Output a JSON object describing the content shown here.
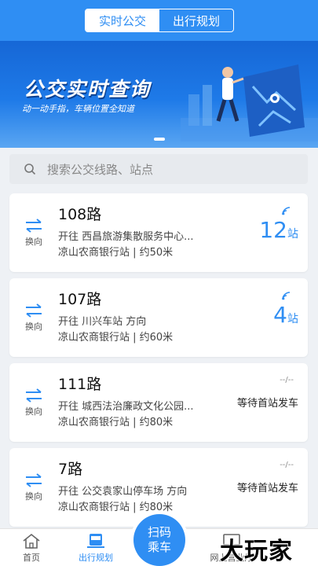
{
  "header": {
    "tabs": [
      {
        "label": "实时公交"
      },
      {
        "label": "出行规划"
      }
    ]
  },
  "banner": {
    "title": "公交实时查询",
    "subtitle": "动一动手指，车辆位置全知道"
  },
  "search": {
    "placeholder": "搜索公交线路、站点"
  },
  "cards": [
    {
      "swap_label": "换向",
      "route": "108路",
      "direction": "开往 西昌旅游集散服务中心...",
      "stop": "凉山农商银行站 | 约50米",
      "count": "12",
      "unit": "站"
    },
    {
      "swap_label": "换向",
      "route": "107路",
      "direction": "开往 川兴车站 方向",
      "stop": "凉山农商银行站 | 约60米",
      "count": "4",
      "unit": "站"
    },
    {
      "swap_label": "换向",
      "route": "111路",
      "direction": "开往 城西法治廉政文化公园...",
      "stop": "凉山农商银行站 | 约80米",
      "dash": "--/--",
      "wait": "等待首站发车"
    },
    {
      "swap_label": "换向",
      "route": "7路",
      "direction": "开往 公交袁家山停车场 方向",
      "stop": "凉山农商银行站 | 约80米",
      "dash": "--/--",
      "wait": "等待首站发车"
    }
  ],
  "tabbar": {
    "home": "首页",
    "plan": "出行规划",
    "scan_line1": "扫码",
    "scan_line2": "乘车",
    "online": "网上营业厅"
  },
  "watermark": "大玩家",
  "colors": {
    "primary": "#2f8ef3",
    "background": "#eef1f5"
  },
  "icons": [
    "search-icon",
    "swap-icon",
    "signal-icon",
    "home-icon",
    "bus-icon",
    "online-hall-icon"
  ]
}
